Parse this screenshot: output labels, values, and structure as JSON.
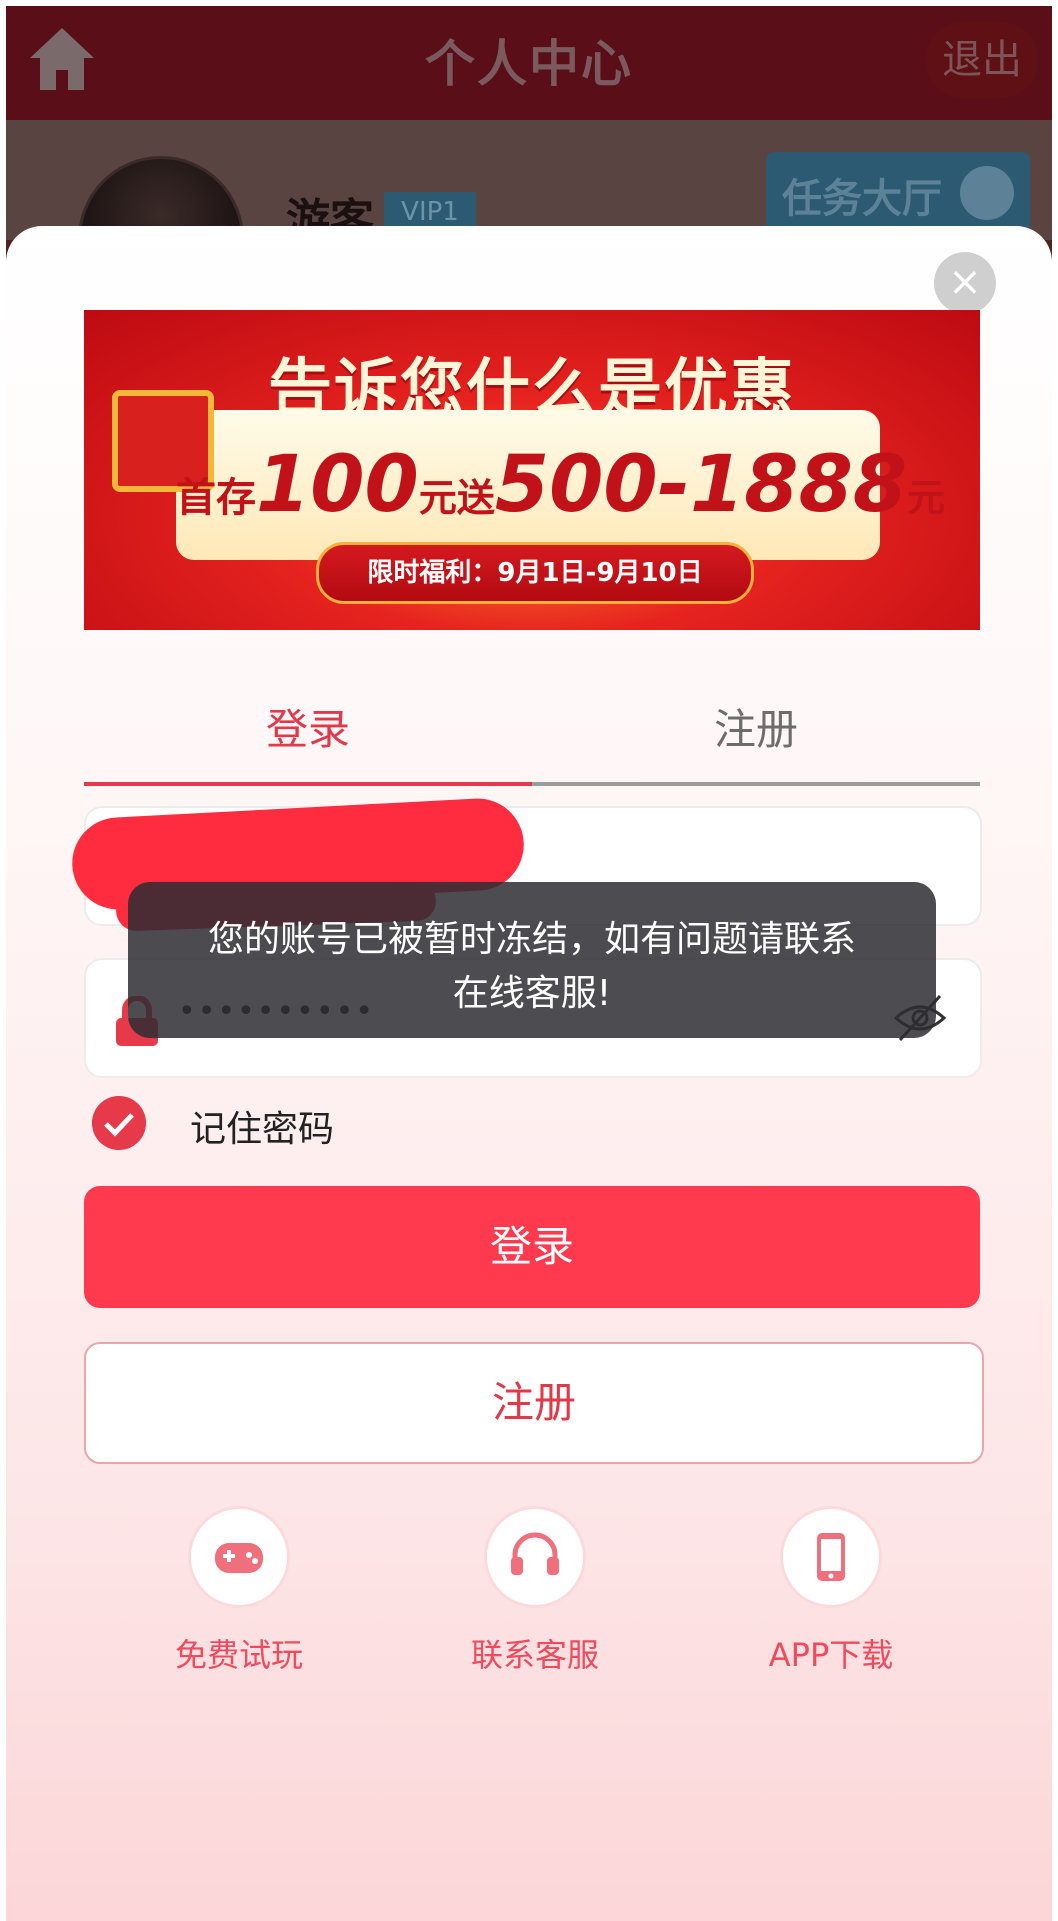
{
  "header": {
    "title": "个人中心",
    "logout_label": "退出"
  },
  "profile": {
    "username": "游客",
    "vip_badge": "VIP1",
    "task_button_label": "任务大厅"
  },
  "banner": {
    "headline": "告诉您什么是优惠",
    "offer": {
      "prefix": "首存",
      "deposit": "100",
      "mid": "元送",
      "bonus": "500-1888",
      "suffix": "元"
    },
    "limited_time": "限时福利：9月1日-9月10日"
  },
  "tabs": [
    {
      "label": "登录"
    },
    {
      "label": "注册"
    }
  ],
  "form": {
    "password_masked": "••••••••••",
    "remember_label": "记住密码"
  },
  "toast": {
    "line1": "您的账号已被暂时冻结，如有问题请联系",
    "line2": "在线客服!"
  },
  "buttons": {
    "login": "登录",
    "register": "注册"
  },
  "actions": [
    {
      "label": "免费试玩",
      "icon": "gamepad-icon"
    },
    {
      "label": "联系客服",
      "icon": "headset-icon"
    },
    {
      "label": "APP下载",
      "icon": "phone-icon"
    }
  ],
  "colors": {
    "accent": "#ff3a4e",
    "header_dark": "#5a0f18"
  }
}
